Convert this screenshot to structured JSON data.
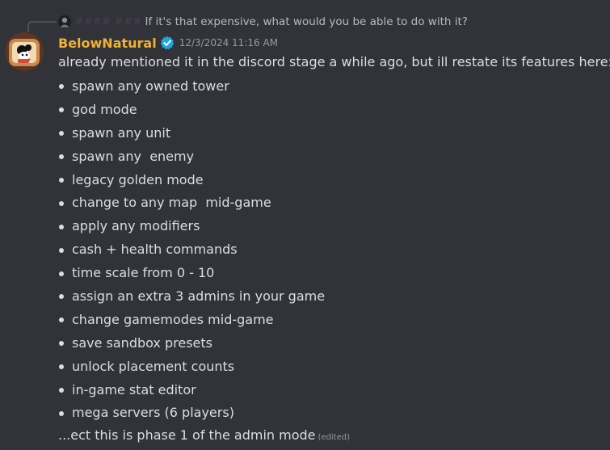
{
  "reply": {
    "author": "#### ###",
    "text": "If it's that expensive, what would you be able to do with it?"
  },
  "message": {
    "username": "BelowNatural",
    "badge_icon": "verified-check-icon",
    "timestamp": "12/3/2024 11:16 AM",
    "intro": "already mentioned it in the discord stage a while ago, but ill restate its features here:",
    "features": [
      "spawn any owned tower",
      "god mode",
      "spawn any unit",
      "spawn any  enemy",
      "legacy golden mode",
      "change to any map  mid-game",
      "apply any modifiers",
      "cash + health commands",
      "time scale from 0 - 10",
      "assign an extra 3 admins in your game",
      "change gamemodes mid-game",
      "save sandbox presets",
      "unlock placement counts",
      "in-game stat editor",
      "mega servers (6 players)"
    ],
    "outro": "...ect this is phase 1 of the admin mode",
    "edited_label": "(edited)"
  },
  "colors": {
    "background": "#313338",
    "username": "#f0b132",
    "text": "#dbdee1",
    "muted": "#949ba4",
    "badge": "#23a5e0"
  }
}
